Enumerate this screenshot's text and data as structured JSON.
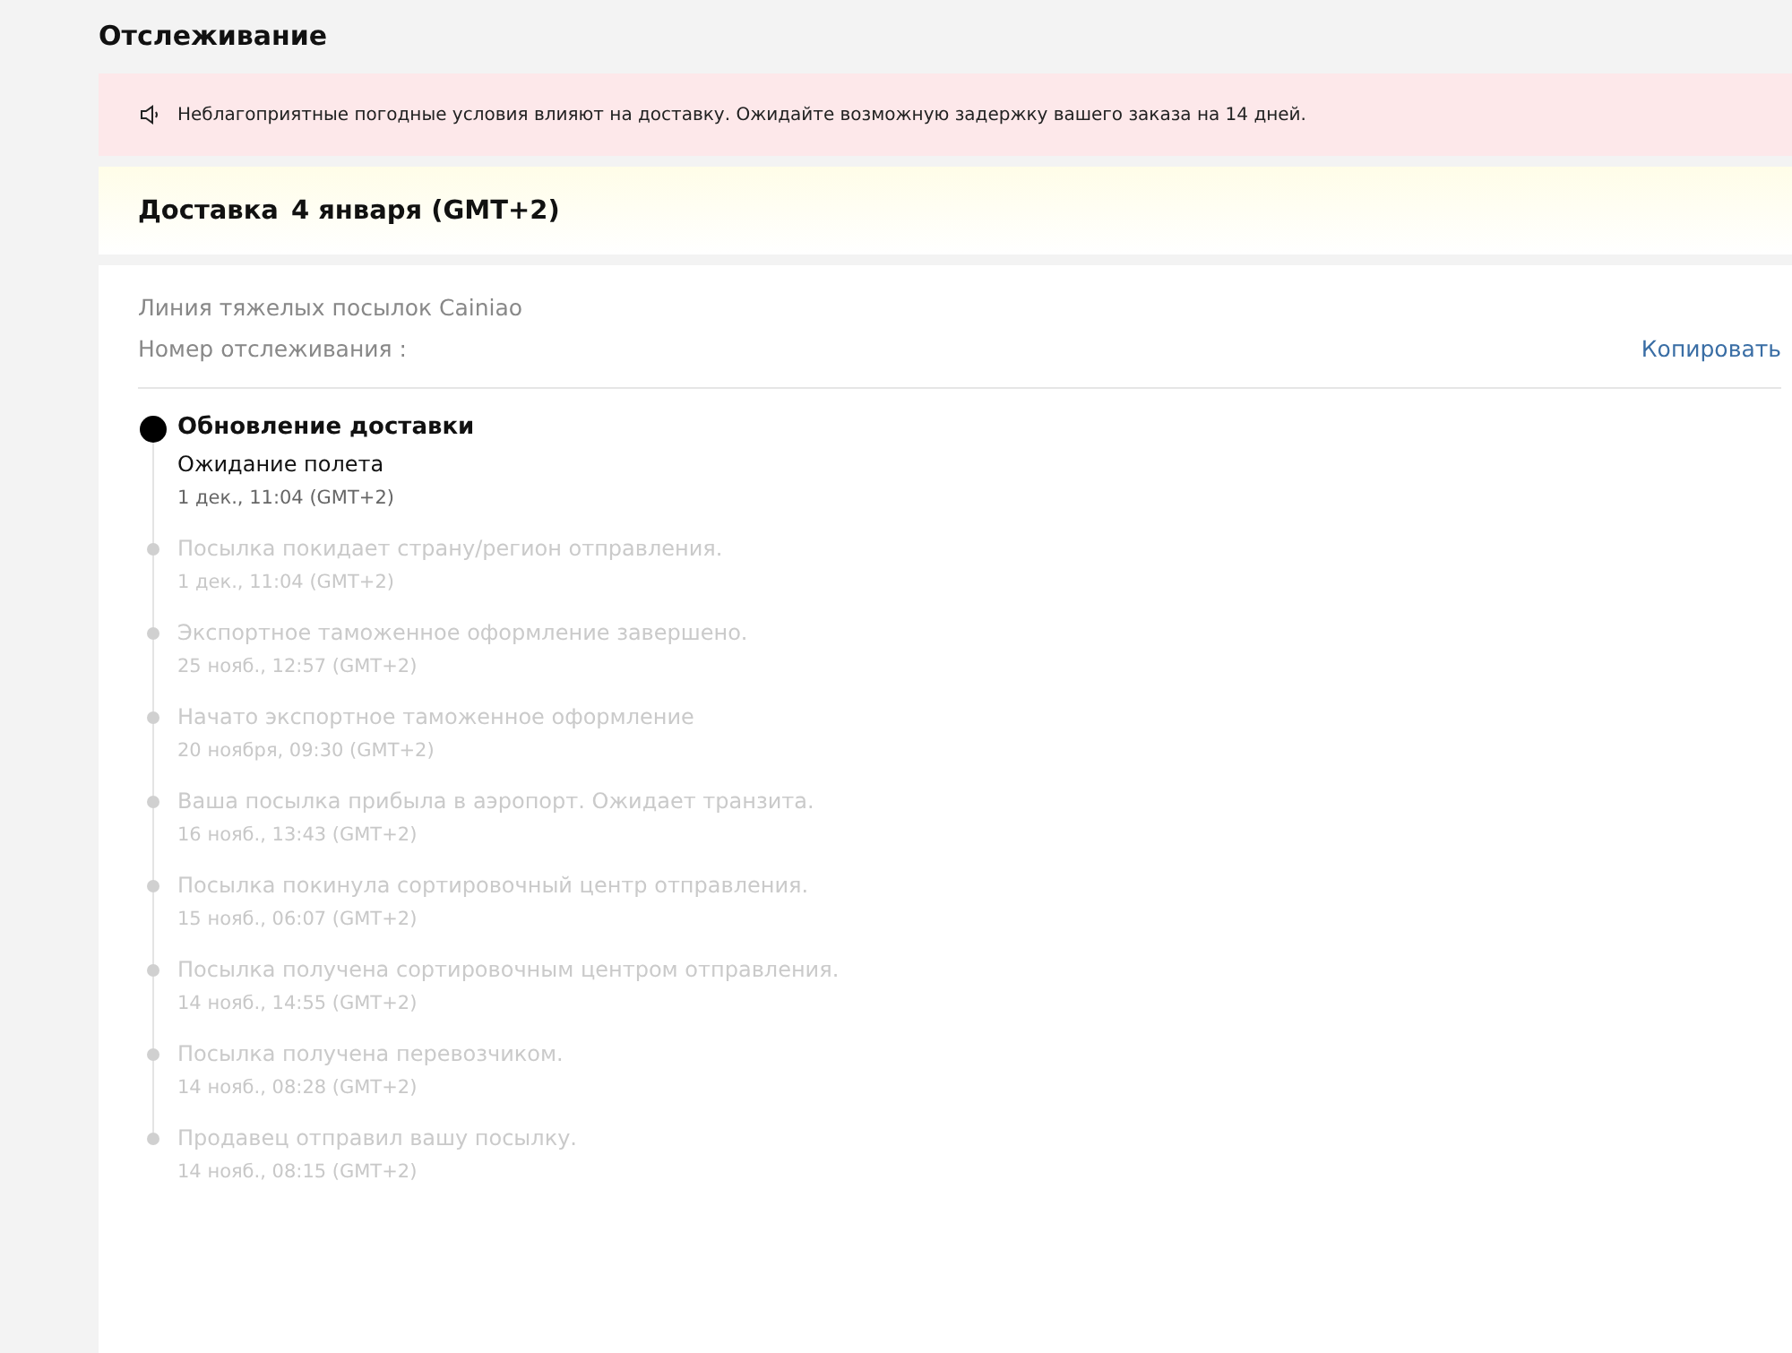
{
  "page_title": "Отслеживание",
  "alert": {
    "text": "Неблагоприятные погодные условия влияют на доставку. Ожидайте возможную задержку вашего заказа на 14 дней."
  },
  "delivery": {
    "label": "Доставка",
    "date": "4 января (GMT+2)"
  },
  "carrier": "Линия тяжелых посылок Cainiao",
  "tracking_label": "Номер отслеживания :",
  "copy_link": "Копировать",
  "events": [
    {
      "current": true,
      "heading": "Обновление доставки",
      "status": "Ожидание полета",
      "time": "1 дек., 11:04 (GMT+2)"
    },
    {
      "current": false,
      "status": "Посылка покидает страну/регион отправления.",
      "time": "1 дек., 11:04 (GMT+2)"
    },
    {
      "current": false,
      "status": "Экспортное таможенное оформление завершено.",
      "time": "25 нояб., 12:57 (GMT+2)"
    },
    {
      "current": false,
      "status": "Начато экспортное таможенное оформление",
      "time": "20 ноября, 09:30 (GMT+2)"
    },
    {
      "current": false,
      "status": "Ваша посылка прибыла в аэропорт. Ожидает транзита.",
      "time": "16 нояб., 13:43 (GMT+2)"
    },
    {
      "current": false,
      "status": "Посылка покинула сортировочный центр отправления.",
      "time": "15 нояб., 06:07 (GMT+2)"
    },
    {
      "current": false,
      "status": "Посылка получена сортировочным центром отправления.",
      "time": "14 нояб., 14:55 (GMT+2)"
    },
    {
      "current": false,
      "status": "Посылка получена перевозчиком.",
      "time": "14 нояб., 08:28 (GMT+2)"
    },
    {
      "current": false,
      "status": "Продавец отправил вашу посылку.",
      "time": "14 нояб., 08:15 (GMT+2)"
    }
  ]
}
